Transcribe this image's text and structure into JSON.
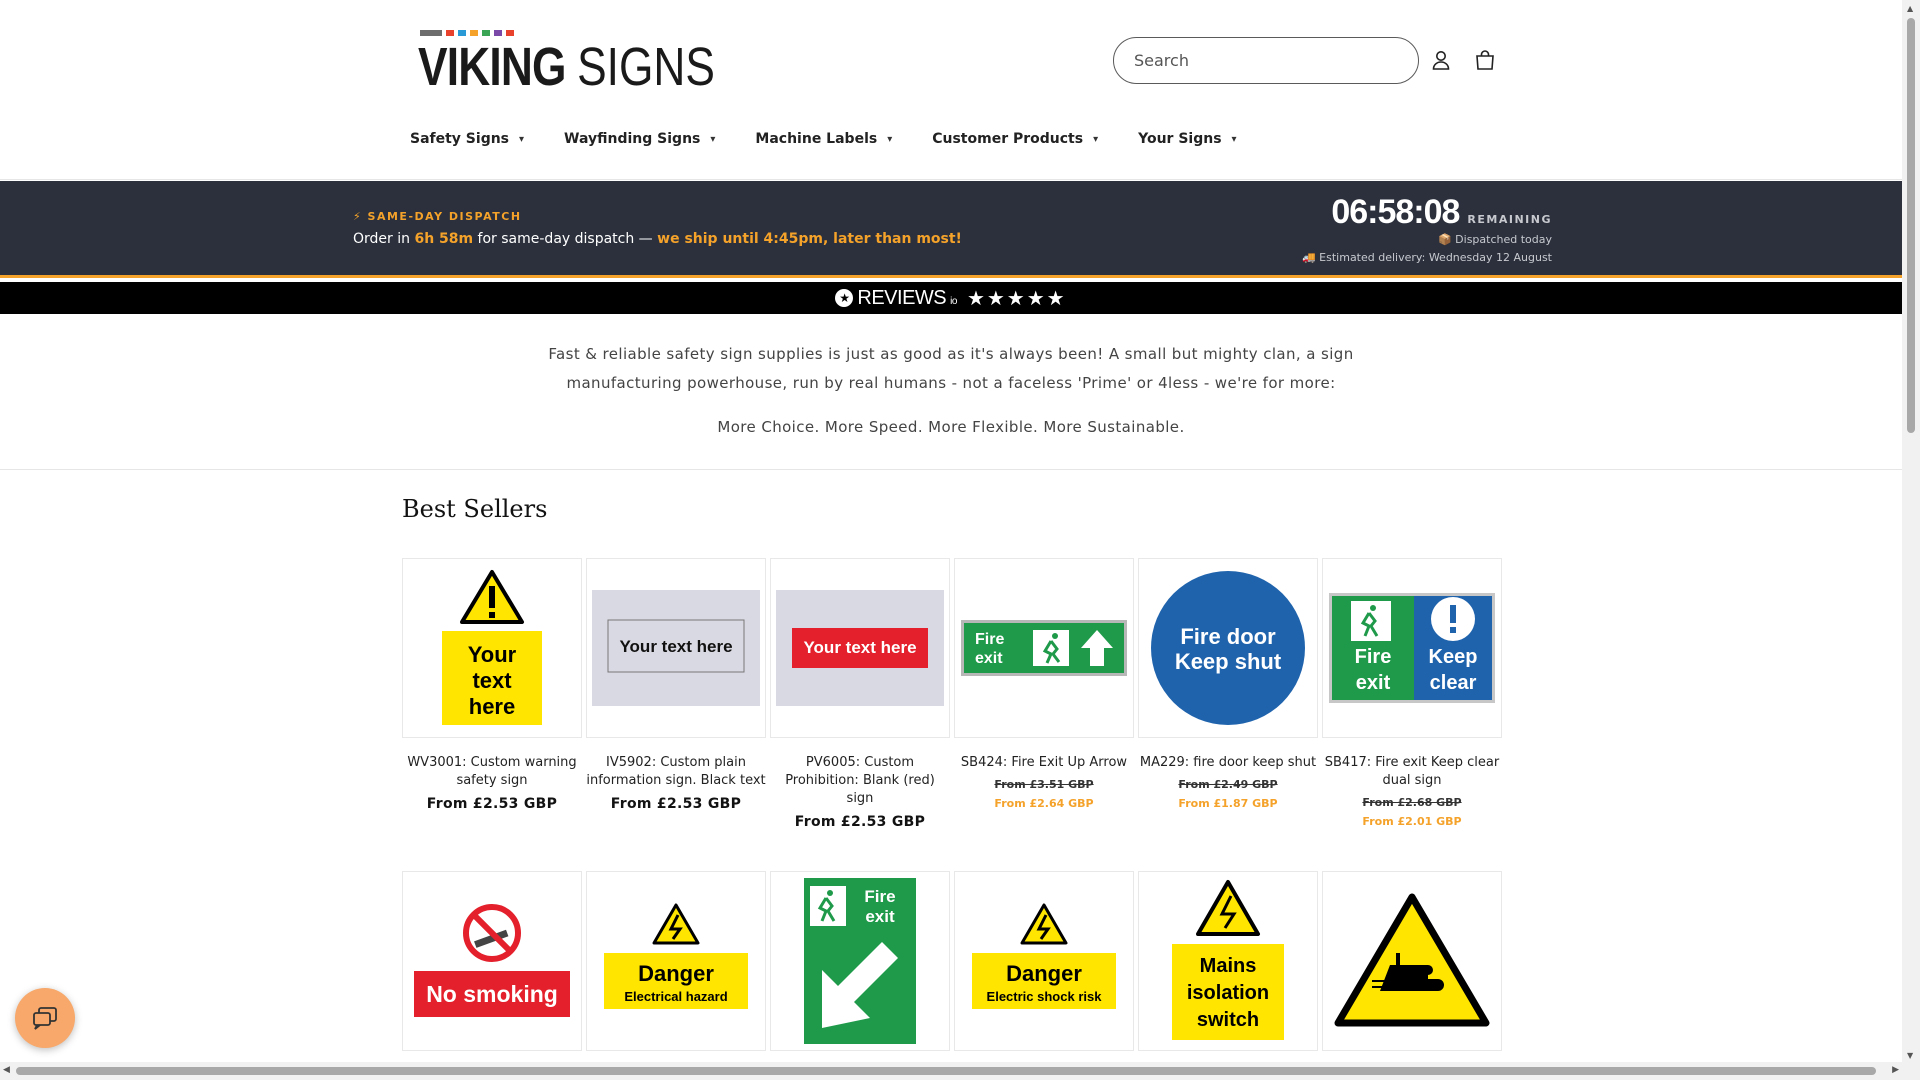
{
  "header": {
    "logo": {
      "bold": "VIKING",
      "light": "SIGNS",
      "colors": [
        "#6d6d6d",
        "#e8412c",
        "#2a9ad6",
        "#f4a22a",
        "#3aa655",
        "#7b4aa8",
        "#e8412c"
      ]
    },
    "search_placeholder": "Search",
    "account_icon": "account-icon",
    "cart_icon": "cart-icon"
  },
  "nav": [
    {
      "label": "Safety Signs"
    },
    {
      "label": "Wayfinding Signs"
    },
    {
      "label": "Machine Labels"
    },
    {
      "label": "Customer Products"
    },
    {
      "label": "Your Signs"
    }
  ],
  "dispatch": {
    "tag": "⚡ SAME-DAY DISPATCH",
    "msg_pre": "Order in ",
    "msg_time": "6h 58m",
    "msg_mid": " for same-day dispatch — ",
    "msg_hl": "we ship until 4:45pm, later than most!",
    "timer": "06:58:08",
    "remaining": "REMAINING",
    "dispatched": "📦 Dispatched today",
    "delivery": "🚚 Estimated delivery: Wednesday 12 August",
    "accent": "#f4a22a",
    "bg": "#2b303c"
  },
  "reviews": {
    "logo": "REVIEWS",
    "suffix": "io",
    "stars": "★★★★★"
  },
  "intro": {
    "line1": "Fast & reliable safety sign supplies is just as good as it's always been! A small but mighty clan, a sign",
    "line2": "manufacturing powerhouse, run by real humans - not a faceless 'Prime' or 4less - we're for more:",
    "tagline": "More Choice. More Speed. More Flexible. More Sustainable."
  },
  "best_sellers": {
    "title": "Best Sellers",
    "products": [
      {
        "title": "WV3001: Custom warning safety sign",
        "price": "From £2.53 GBP"
      },
      {
        "title": "IV5902: Custom plain information sign. Black text",
        "price": "From £2.53 GBP"
      },
      {
        "title": "PV6005: Custom Prohibition: Blank (red) sign",
        "price": "From £2.53 GBP"
      },
      {
        "title": "SB424: Fire Exit Up Arrow",
        "old_price": "From £3.51 GBP",
        "sale_price": "From £2.64 GBP"
      },
      {
        "title": "MA229: fire door keep shut",
        "old_price": "From £2.49 GBP",
        "sale_price": "From £1.87 GBP"
      },
      {
        "title": "SB417: Fire exit Keep clear dual sign",
        "old_price": "From £2.68 GBP",
        "sale_price": "From £2.01 GBP"
      }
    ],
    "images": {
      "warning_text": [
        "Your",
        "text",
        "here"
      ],
      "plain_text": "Your text here",
      "red_text": "Your text here",
      "fire_exit": [
        "Fire",
        "exit"
      ],
      "fire_door": [
        "Fire door",
        "Keep shut"
      ],
      "dual_left": [
        "Fire",
        "exit"
      ],
      "dual_right": [
        "Keep",
        "clear"
      ],
      "no_smoking": "No smoking",
      "danger1": [
        "Danger",
        "Electrical hazard"
      ],
      "fire_exit2": [
        "Fire",
        "exit"
      ],
      "danger2": [
        "Danger",
        "Electric shock risk"
      ],
      "mains": [
        "Mains",
        "isolation",
        "switch"
      ]
    }
  }
}
